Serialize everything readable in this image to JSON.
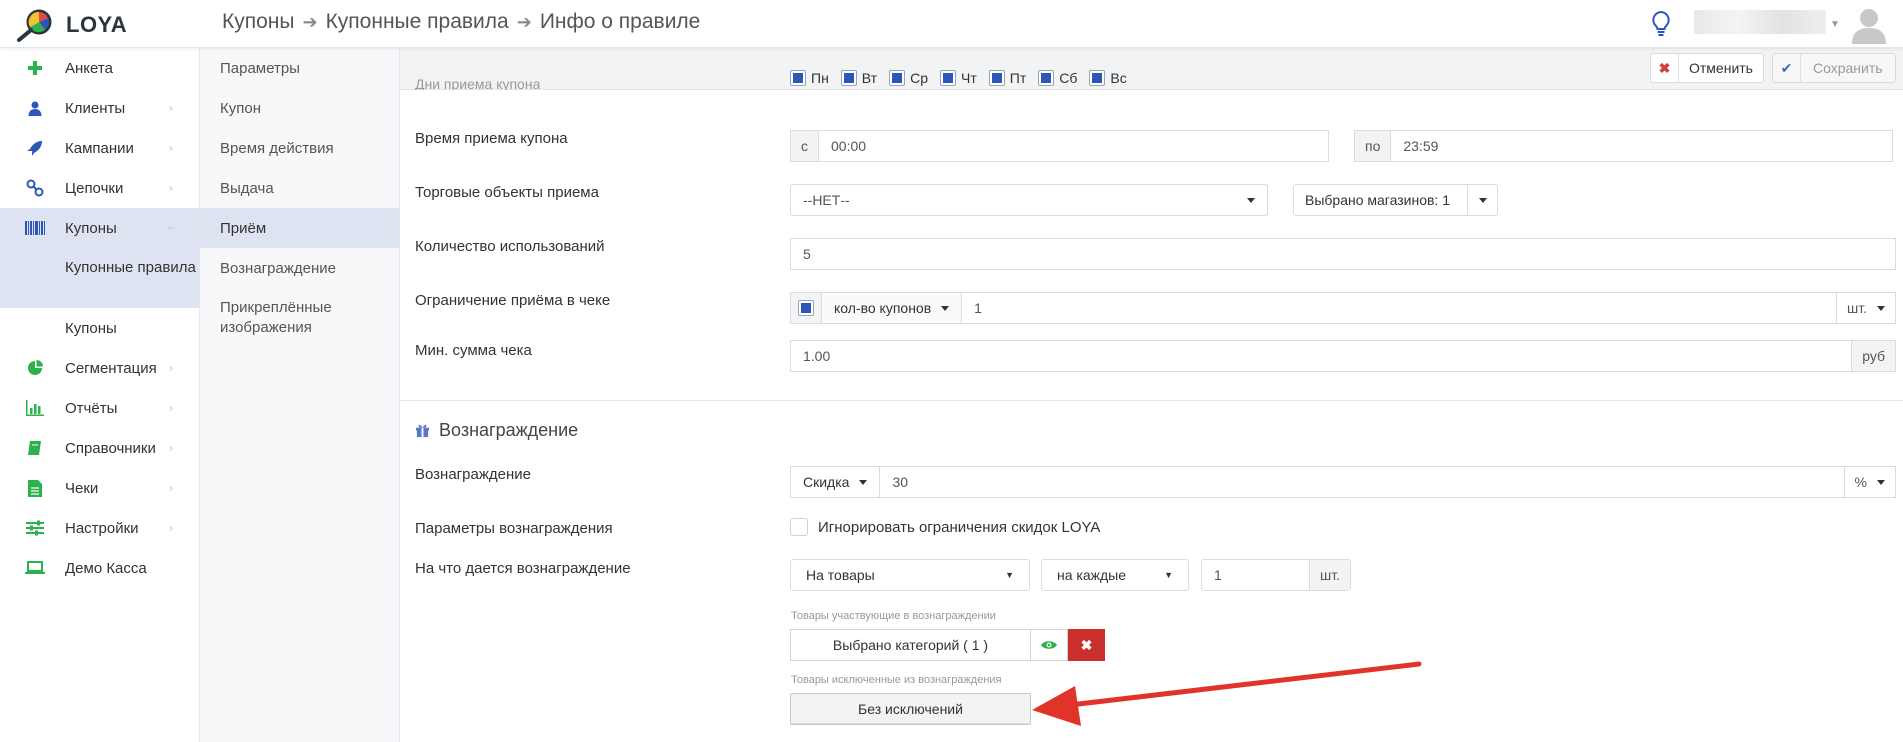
{
  "app": {
    "name": "LOYA"
  },
  "breadcrumb": [
    "Купоны",
    "Купонные правила",
    "Инфо о правиле"
  ],
  "sidebar": {
    "items": [
      {
        "label": "Анкета",
        "icon": "plus-icon",
        "color": "#2bb24c"
      },
      {
        "label": "Клиенты",
        "icon": "user-icon",
        "color": "#2c56b8"
      },
      {
        "label": "Кампании",
        "icon": "rocket-icon",
        "color": "#2c56b8"
      },
      {
        "label": "Цепочки",
        "icon": "link-icon",
        "color": "#2c56b8"
      },
      {
        "label": "Купоны",
        "icon": "barcode-icon",
        "color": "#2c56b8"
      },
      {
        "label": "Сегментация",
        "icon": "pie-chart-icon",
        "color": "#2bb24c"
      },
      {
        "label": "Отчёты",
        "icon": "bar-chart-icon",
        "color": "#2bb24c"
      },
      {
        "label": "Справочники",
        "icon": "book-icon",
        "color": "#2bb24c"
      },
      {
        "label": "Чеки",
        "icon": "receipt-icon",
        "color": "#2bb24c"
      },
      {
        "label": "Настройки",
        "icon": "sliders-icon",
        "color": "#2bb24c"
      },
      {
        "label": "Демо Касса",
        "icon": "laptop-icon",
        "color": "#2bb24c"
      }
    ],
    "coupon_sub": [
      "Купонные правила",
      "Купоны"
    ]
  },
  "subnav": [
    "Параметры",
    "Купон",
    "Время действия",
    "Выдача",
    "Приём",
    "Вознаграждение",
    "Прикреплённые изображения"
  ],
  "toolbar": {
    "ghost_label": "Дни приема купона",
    "cancel": "Отменить",
    "save": "Сохранить"
  },
  "days": [
    "Пн",
    "Вт",
    "Ср",
    "Чт",
    "Пт",
    "Сб",
    "Вс"
  ],
  "form": {
    "time_label": "Время приема купона",
    "time_from_prefix": "с",
    "time_from": "00:00",
    "time_to_prefix": "по",
    "time_to": "23:59",
    "stores_label": "Торговые объекты приема",
    "stores_value": "--НЕТ--",
    "stores_selected": "Выбрано магазинов: 1",
    "count_label": "Количество использований",
    "count_value": "5",
    "limit_label": "Ограничение приёма в чеке",
    "limit_type": "кол-во купонов",
    "limit_value": "1",
    "limit_unit": "шт.",
    "min_sum_label": "Мин. сумма чека",
    "min_sum_value": "1.00",
    "min_sum_unit": "руб"
  },
  "reward": {
    "section_title": "Вознаграждение",
    "reward_label": "Вознаграждение",
    "reward_type": "Скидка",
    "reward_value": "30",
    "reward_unit": "%",
    "params_label": "Параметры вознаграждения",
    "ignore_label": "Игнорировать ограничения скидок LOYA",
    "target_label": "На что дается вознаграждение",
    "target_value": "На товары",
    "per_value": "на каждые",
    "qty_value": "1",
    "qty_unit": "шт.",
    "included_hint": "Товары участвующие в вознаграждении",
    "included_btn": "Выбрано категорий ( 1 )",
    "excluded_hint": "Товары исключенные из вознаграждения",
    "excluded_btn": "Без исключений"
  },
  "colors": {
    "accent": "#2c56b8",
    "active_bg": "#dde3f0",
    "danger": "#c9302c",
    "arrow": "#e0342a"
  }
}
